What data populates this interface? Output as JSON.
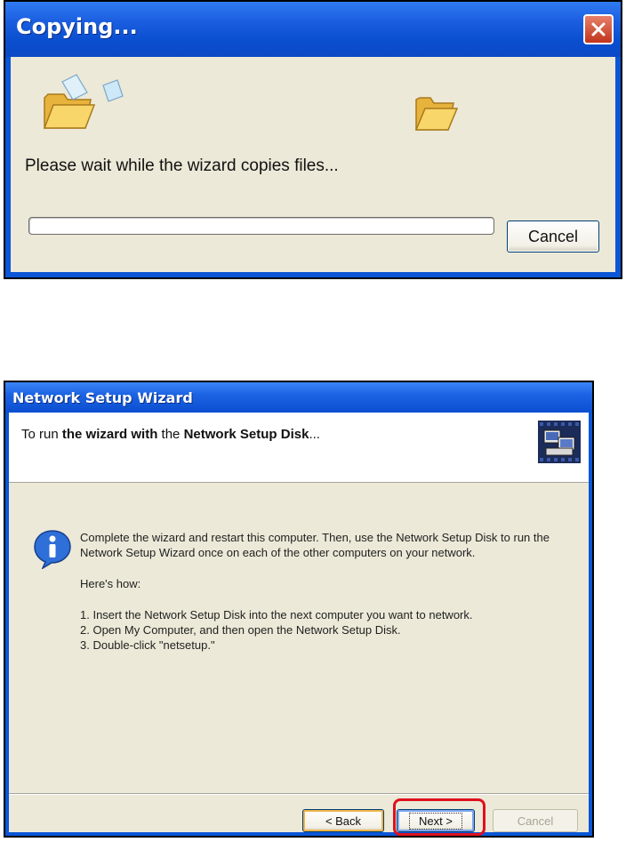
{
  "copy_dialog": {
    "title": "Copying...",
    "message": "Please wait while the wizard copies files...",
    "progress": 0,
    "cancel_label": "Cancel"
  },
  "wizard_dialog": {
    "title": "Network Setup Wizard",
    "heading_prefix": "To run ",
    "heading_bold1": "the wizard with",
    "heading_mid": " the ",
    "heading_bold2": "Network Setup Disk",
    "heading_suffix": "...",
    "intro": "Complete the wizard and restart this computer. Then, use the Network Setup Disk to run the Network Setup Wizard once on each of the other computers on your network.",
    "heres_how": "Here's how:",
    "steps": [
      "1.  Insert the Network Setup Disk into the next computer you want to network.",
      "2.  Open My Computer, and then open the Network Setup Disk.",
      "3.  Double-click \"netsetup.\""
    ],
    "back_label": "< Back",
    "next_label": "Next >",
    "cancel_label": "Cancel"
  },
  "colors": {
    "title_blue": "#0a56d6",
    "dialog_face": "#ece9d8",
    "close_red": "#c0351c",
    "highlight_red": "#e0101e"
  }
}
